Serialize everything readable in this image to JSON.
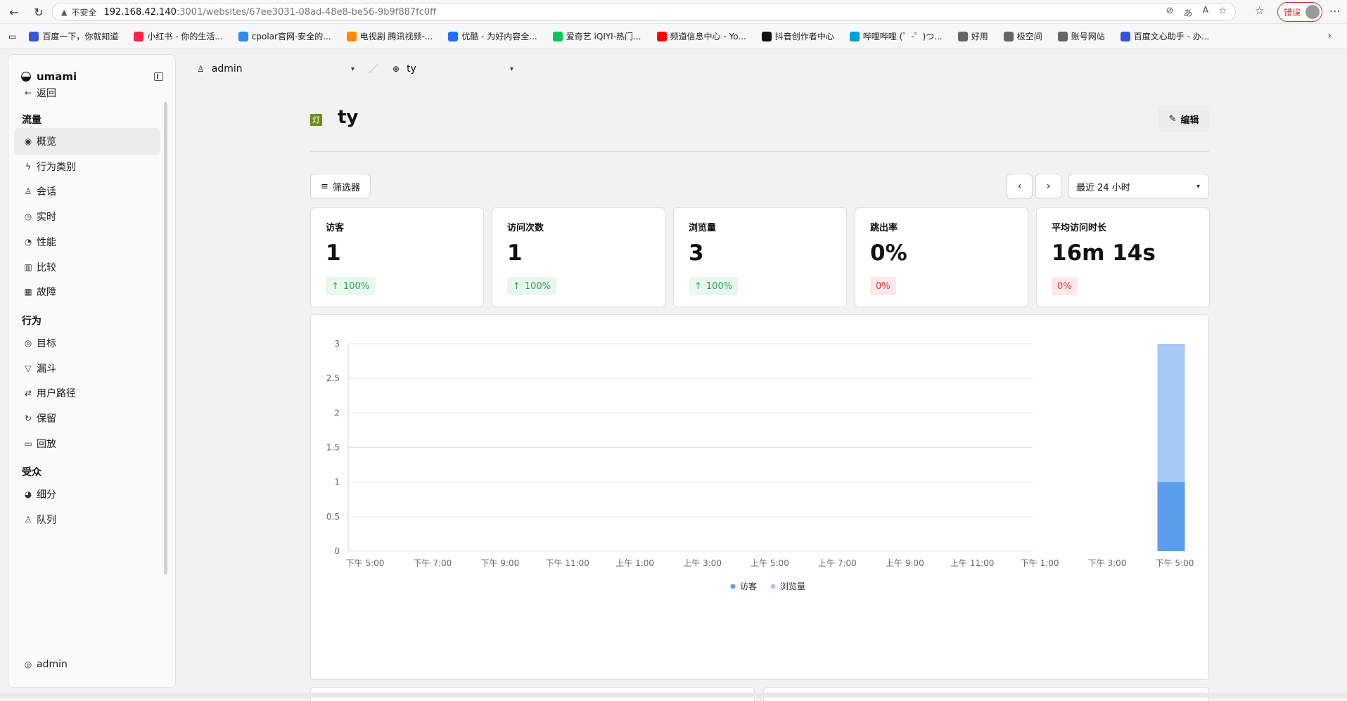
{
  "browser": {
    "security_label": "不安全",
    "url_host": "192.168.42.140",
    "url_path": ":3001/websites/67ee3031-08ad-48e8-be56-9b9f887fc0ff",
    "error_label": "错误",
    "bookmarks": [
      {
        "label": "百度一下，你就知道",
        "color": "#3355dd"
      },
      {
        "label": "小红书 - 你的生活...",
        "color": "#ff2442"
      },
      {
        "label": "cpolar官网-安全的...",
        "color": "#2a8cf0"
      },
      {
        "label": "电视剧 腾讯视频-...",
        "color": "#ff8a00"
      },
      {
        "label": "优酷 - 为好内容全...",
        "color": "#1f6fff"
      },
      {
        "label": "爱奇艺 iQIYI-热门...",
        "color": "#00c853"
      },
      {
        "label": "频道信息中心 - Yo...",
        "color": "#ff0000"
      },
      {
        "label": "抖音创作者中心",
        "color": "#111111"
      },
      {
        "label": "哔哩哔哩 (゜-゜)つ...",
        "color": "#00a1d6"
      },
      {
        "label": "好用",
        "color": "#666666"
      },
      {
        "label": "极空间",
        "color": "#666666"
      },
      {
        "label": "账号网站",
        "color": "#666666"
      },
      {
        "label": "百度文心助手 - 办...",
        "color": "#3355dd"
      }
    ]
  },
  "sidebar": {
    "brand": "umami",
    "back": "返回",
    "section_traffic": "流量",
    "items_traffic": [
      "概览",
      "行为类别",
      "会话",
      "实时",
      "性能",
      "比较",
      "故障"
    ],
    "section_behavior": "行为",
    "items_behavior": [
      "目标",
      "漏斗",
      "用户路径",
      "保留",
      "回放"
    ],
    "section_audience": "受众",
    "items_audience": [
      "细分",
      "队列"
    ],
    "user": "admin"
  },
  "crumbs": {
    "user": "admin",
    "site": "ty"
  },
  "header": {
    "badge": "灯",
    "title": "ty",
    "edit": "编辑"
  },
  "toolbar": {
    "filter": "筛选器",
    "prev": "‹",
    "next": "›",
    "range": "最近 24 小时"
  },
  "metrics": [
    {
      "label": "访客",
      "value": "1",
      "change": "100%",
      "trend": "up"
    },
    {
      "label": "访问次数",
      "value": "1",
      "change": "100%",
      "trend": "up"
    },
    {
      "label": "浏览量",
      "value": "3",
      "change": "100%",
      "trend": "up"
    },
    {
      "label": "跳出率",
      "value": "0%",
      "change": "0%",
      "trend": "neutral"
    },
    {
      "label": "平均访问时长",
      "value": "16m 14s",
      "change": "0%",
      "trend": "neutral"
    }
  ],
  "colors": {
    "visitors": "#5b9ded",
    "views": "#a7c9f6",
    "up": "#2ca44f",
    "down": "#e23a3a"
  },
  "chart_data": {
    "type": "bar",
    "stacked": true,
    "categories": [
      "下午 5:00",
      "下午 7:00",
      "下午 9:00",
      "下午 11:00",
      "上午 1:00",
      "上午 3:00",
      "上午 5:00",
      "上午 7:00",
      "上午 9:00",
      "上午 11:00",
      "下午 1:00",
      "下午 3:00",
      "下午 5:00"
    ],
    "yticks": [
      "0",
      "0.5",
      "1",
      "1.5",
      "2",
      "2.5",
      "3"
    ],
    "ylim": [
      0,
      3
    ],
    "grid": true,
    "legend_position": "bottom",
    "series": [
      {
        "name": "访客",
        "values": [
          0,
          0,
          0,
          0,
          0,
          0,
          0,
          0,
          0,
          0,
          0,
          0,
          1
        ]
      },
      {
        "name": "浏览量",
        "values": [
          0,
          0,
          0,
          0,
          0,
          0,
          0,
          0,
          0,
          0,
          0,
          0,
          3
        ]
      }
    ]
  }
}
